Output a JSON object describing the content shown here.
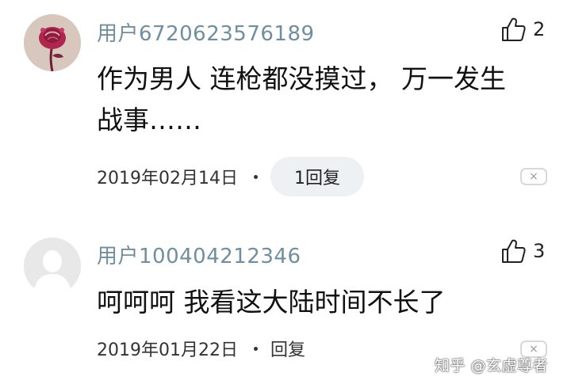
{
  "comments": [
    {
      "username": "用户6720623576189",
      "like_count": "2",
      "content": "作为男人 连枪都没摸过， 万一发生\n战事……",
      "date": "2019年02月14日",
      "reply_label": "1回复",
      "close_symbol": "×",
      "avatar_icon": "rose-avatar-icon"
    },
    {
      "username": "用户100404212346",
      "like_count": "3",
      "content": "呵呵呵 我看这大陆时间不长了",
      "date": "2019年01月22日",
      "reply_label": "回复",
      "close_symbol": "×",
      "avatar_icon": "default-user-avatar-icon"
    }
  ],
  "watermark": "知乎 @玄虚尊者",
  "colors": {
    "username": "#6f8fa0",
    "content": "#111111",
    "reply_pill_bg": "#eef1f3"
  }
}
